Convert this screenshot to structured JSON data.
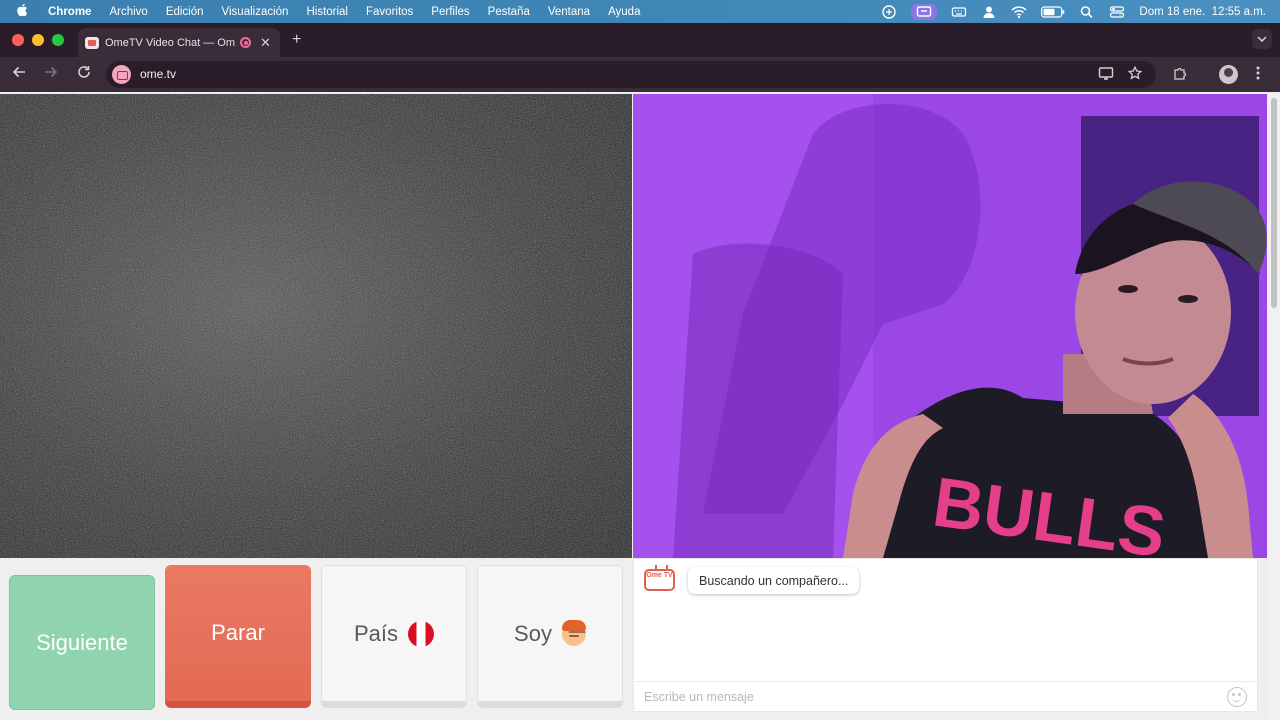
{
  "menubar": {
    "apple_icon": "apple-icon",
    "items": [
      "Chrome",
      "Archivo",
      "Edición",
      "Visualización",
      "Historial",
      "Favoritos",
      "Perfiles",
      "Pestaña",
      "Ventana",
      "Ayuda"
    ],
    "clock": "Dom 18 ene.  12:55 a.m.",
    "tray_icons": [
      "cloud-sync-icon",
      "screen-mirroring-icon",
      "keyboard-icon",
      "user-icon",
      "wifi-icon",
      "battery-icon",
      "search-icon",
      "control-center-icon"
    ]
  },
  "browser": {
    "tab_title": "OmeTV Video Chat — Ome",
    "url": "ome.tv",
    "new_tab": "+",
    "close_tab": "✕"
  },
  "controls": {
    "next_label": "Siguiente",
    "stop_label": "Parar",
    "country_label": "País",
    "iam_label": "Soy"
  },
  "chat": {
    "logo_text": "Ome TV",
    "status_message": "Buscando un compañero...",
    "input_placeholder": "Escribe un mensaje"
  },
  "colors": {
    "next": "#8fd4ac",
    "stop": "#e36a53",
    "accent": "#e45d4d"
  }
}
